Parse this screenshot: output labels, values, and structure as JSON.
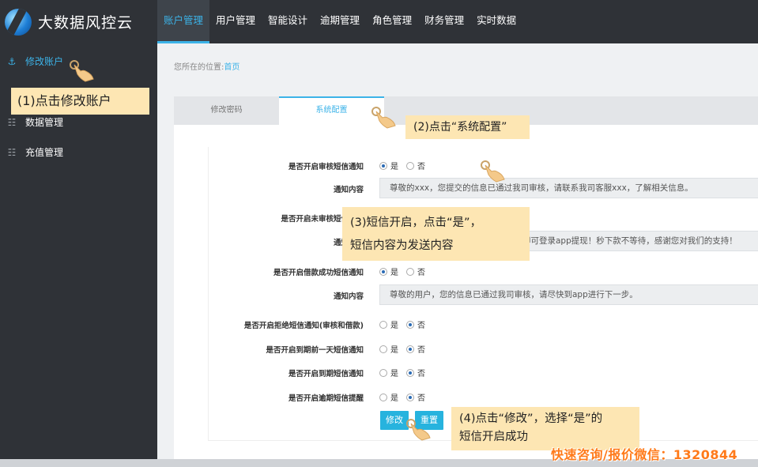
{
  "app": {
    "title": "大数据风控云"
  },
  "nav": [
    {
      "label": "账户管理"
    },
    {
      "label": "用户管理"
    },
    {
      "label": "智能设计"
    },
    {
      "label": "逾期管理"
    },
    {
      "label": "角色管理"
    },
    {
      "label": "财务管理"
    },
    {
      "label": "实时数据"
    }
  ],
  "sidebar": [
    {
      "label": "修改账户",
      "icon": "anchor-icon"
    },
    {
      "label": "数据管理",
      "icon": "sliders-icon"
    },
    {
      "label": "充值管理",
      "icon": "sliders-icon"
    }
  ],
  "breadcrumb": {
    "prefix": "您所在的位置:",
    "link": "首页"
  },
  "tabs": [
    {
      "label": "修改密码"
    },
    {
      "label": "系统配置"
    }
  ],
  "form": {
    "yes": "是",
    "no": "否",
    "rows": [
      {
        "label": "是否开启审核短信通知",
        "selected": "yes"
      },
      {
        "label": "通知内容",
        "value": "尊敬的xxx，您提交的信息已通过我司审核，请联系我司客服xxx，了解相关信息。"
      },
      {
        "label": "是否开启未审核短信通知",
        "selected": "yes"
      },
      {
        "label": "通知内容",
        "value": "尊敬的用户，您的借款已放款，现在即可登录app提现！秒下款不等待，感谢您对我们的支持！"
      },
      {
        "label": "是否开启借款成功短信通知",
        "selected": "yes"
      },
      {
        "label": "通知内容",
        "value": "尊敬的用户，您的信息已通过我司审核，请尽快到app进行下一步。"
      },
      {
        "label": "是否开启拒绝短信通知(审核和借款)",
        "selected": "no"
      },
      {
        "label": "是否开启到期前一天短信通知",
        "selected": "no"
      },
      {
        "label": "是否开启到期短信通知",
        "selected": "no"
      },
      {
        "label": "是否开启逾期短信提醒",
        "selected": "no"
      }
    ],
    "submit": "修改",
    "reset": "重置"
  },
  "annotations": {
    "a1": "(1)点击修改账户",
    "a2": "(2)点击“系统配置”",
    "a3_line1": "(3)短信开启，点击“是”，",
    "a3_line2": "短信内容为发送内容",
    "a4_line1": "(4)点击“修改”，选择“是”的",
    "a4_line2": "短信开启成功"
  },
  "watermark": "快速咨询/报价微信：1320844",
  "colors": {
    "topbar": "#2f3237",
    "accent": "#3cb3e8",
    "annotation": "#fde6b3",
    "button": "#27b3de",
    "watermark": "#ff7a1a"
  }
}
